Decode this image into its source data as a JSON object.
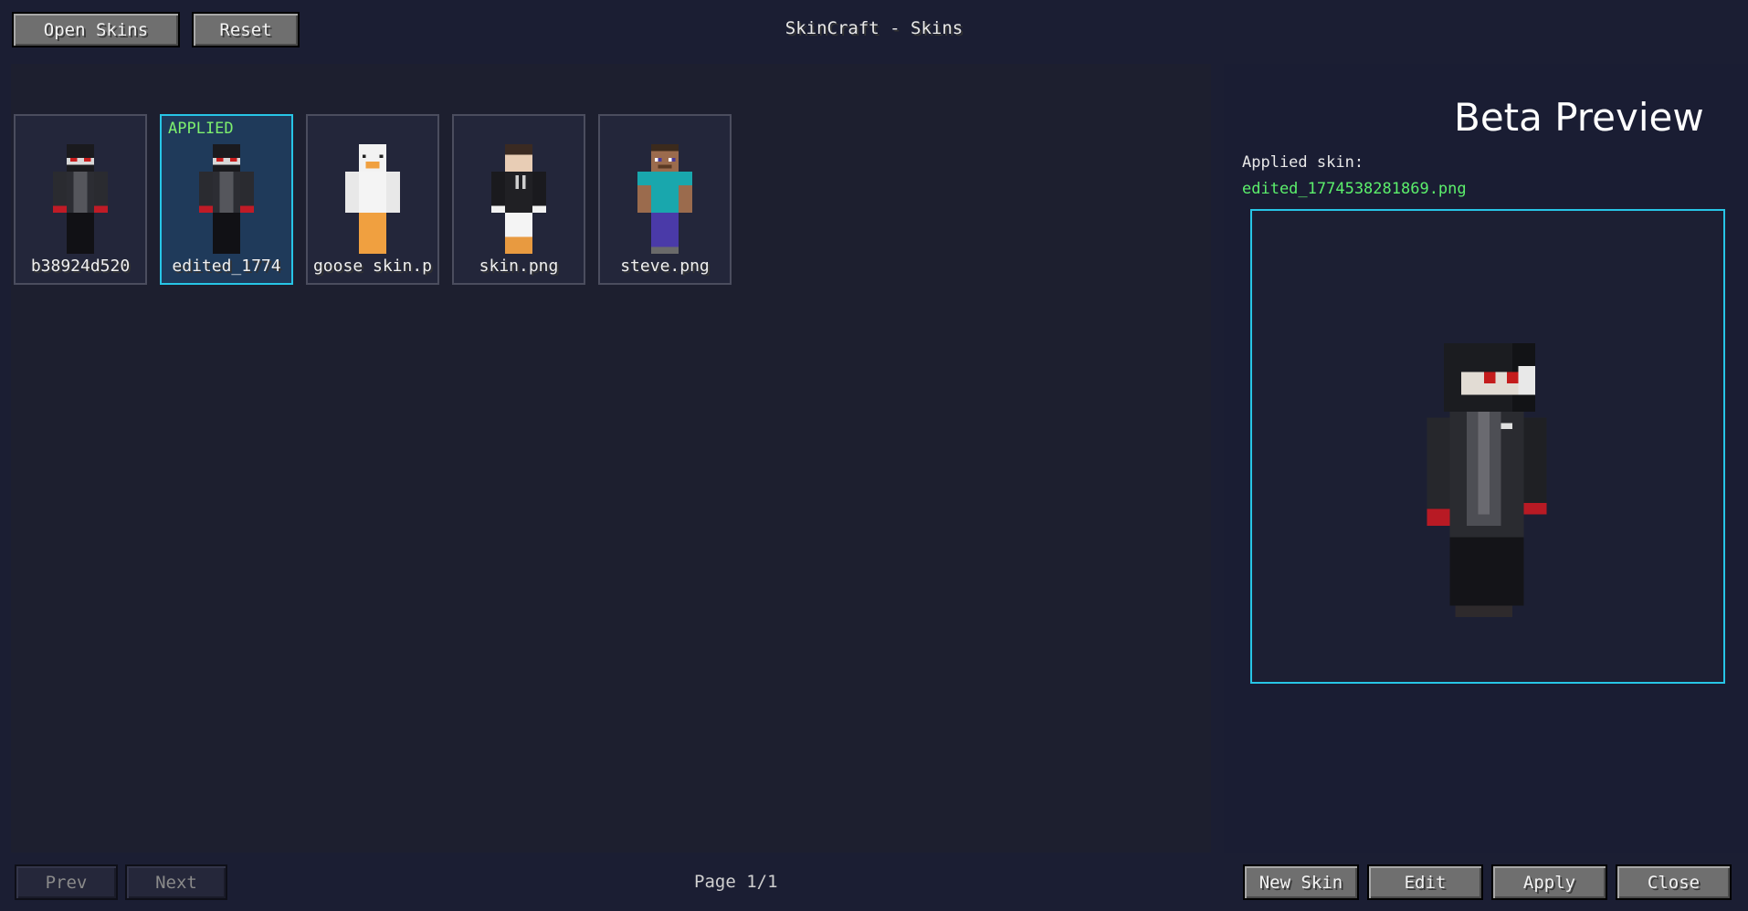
{
  "window": {
    "title": "SkinCraft - Skins"
  },
  "toolbar": {
    "open_skins": "Open Skins",
    "reset": "Reset"
  },
  "skins": [
    {
      "name": "b38924d520",
      "applied": false
    },
    {
      "name": "edited_1774",
      "applied": true,
      "badge": "APPLIED"
    },
    {
      "name": "goose skin.p",
      "applied": false
    },
    {
      "name": "skin.png",
      "applied": false
    },
    {
      "name": "steve.png",
      "applied": false
    }
  ],
  "preview": {
    "heading": "Beta Preview",
    "applied_label": "Applied skin:",
    "applied_file": "edited_1774538281869.png"
  },
  "pagination": {
    "prev": "Prev",
    "next": "Next",
    "page": "Page 1/1"
  },
  "actions": {
    "new_skin": "New Skin",
    "edit": "Edit",
    "apply": "Apply",
    "close": "Close"
  },
  "colors": {
    "background": "#1b1e33",
    "accent": "#27c5e6",
    "applied_text": "#7ef06e",
    "filename_text": "#5cf06c"
  }
}
